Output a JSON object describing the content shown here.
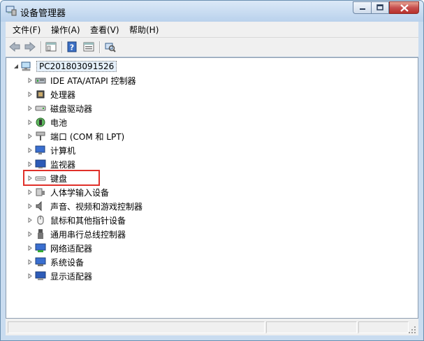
{
  "window": {
    "title": "设备管理器"
  },
  "menu": [
    "文件(F)",
    "操作(A)",
    "查看(V)",
    "帮助(H)"
  ],
  "toolbar": {
    "buttons": [
      "back-icon",
      "forward-icon",
      "show-hide-tree-icon",
      "help-icon",
      "properties-icon",
      "scan-hardware-icon"
    ]
  },
  "tree": {
    "root": {
      "label": "PC201803091526",
      "icon": "computer-icon",
      "expanded": true
    },
    "items": [
      {
        "label": "IDE ATA/ATAPI 控制器",
        "icon": "ide-controller-icon"
      },
      {
        "label": "处理器",
        "icon": "processor-icon"
      },
      {
        "label": "磁盘驱动器",
        "icon": "disk-drive-icon"
      },
      {
        "label": "电池",
        "icon": "battery-icon"
      },
      {
        "label": "端口 (COM 和 LPT)",
        "icon": "port-icon"
      },
      {
        "label": "计算机",
        "icon": "computer-icon"
      },
      {
        "label": "监视器",
        "icon": "monitor-icon"
      },
      {
        "label": "键盘",
        "icon": "keyboard-icon",
        "highlighted": true
      },
      {
        "label": "人体学输入设备",
        "icon": "hid-icon"
      },
      {
        "label": "声音、视频和游戏控制器",
        "icon": "sound-icon"
      },
      {
        "label": "鼠标和其他指针设备",
        "icon": "mouse-icon"
      },
      {
        "label": "通用串行总线控制器",
        "icon": "usb-icon"
      },
      {
        "label": "网络适配器",
        "icon": "network-adapter-icon"
      },
      {
        "label": "系统设备",
        "icon": "system-device-icon"
      },
      {
        "label": "显示适配器",
        "icon": "display-adapter-icon"
      }
    ]
  },
  "colors": {
    "highlight_box": "#e0302a",
    "selection_bg": "#e5f0fb"
  }
}
